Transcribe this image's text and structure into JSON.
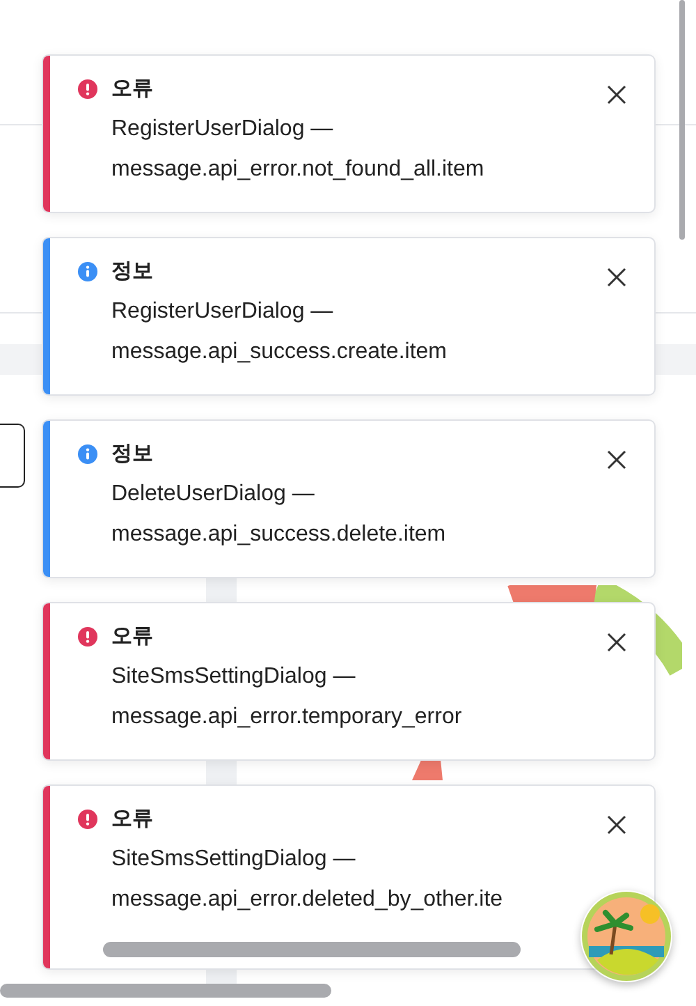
{
  "toasts": [
    {
      "kind": "error",
      "title": "오류",
      "source": "RegisterUserDialog —",
      "message": "message.api_error.not_found_all.item",
      "overflowing": false
    },
    {
      "kind": "info",
      "title": "정보",
      "source": "RegisterUserDialog —",
      "message": "message.api_success.create.item",
      "overflowing": false
    },
    {
      "kind": "info",
      "title": "정보",
      "source": "DeleteUserDialog —",
      "message": "message.api_success.delete.item",
      "overflowing": false
    },
    {
      "kind": "error",
      "title": "오류",
      "source": "SiteSmsSettingDialog —",
      "message": "message.api_error.temporary_error",
      "overflowing": false
    },
    {
      "kind": "error",
      "title": "오류",
      "source": "SiteSmsSettingDialog —",
      "message": "message.api_error.deleted_by_other.ite",
      "overflowing": true
    }
  ]
}
